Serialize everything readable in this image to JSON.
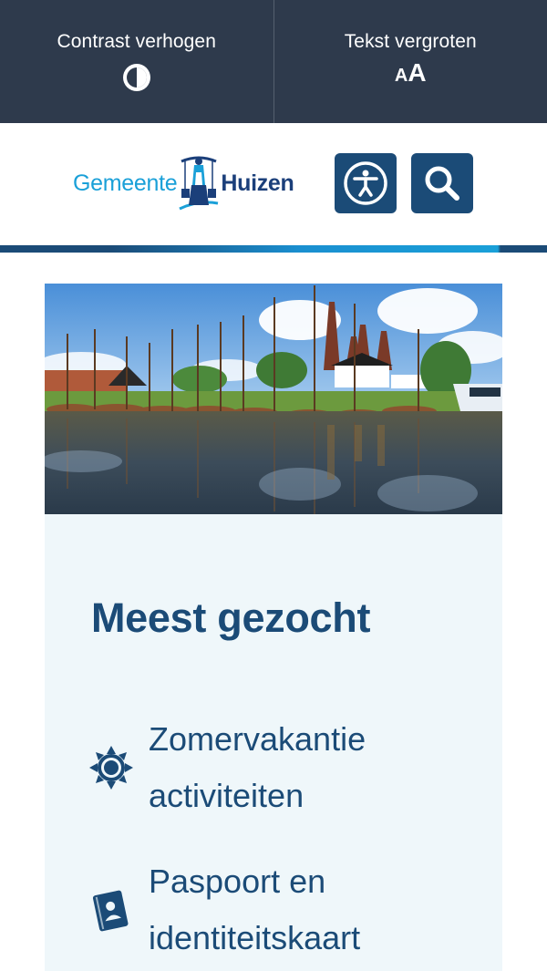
{
  "accessibility_bar": {
    "contrast_label": "Contrast verhogen",
    "text_size_label": "Tekst vergroten",
    "text_size_icon_small": "A",
    "text_size_icon_big": "A"
  },
  "header": {
    "logo_left": "Gemeente",
    "logo_right": "Huizen",
    "accessibility_icon": "accessibility-icon",
    "search_icon": "search-icon"
  },
  "most_searched": {
    "title": "Meest gezocht",
    "items": [
      {
        "label": "Zomervakantie activiteiten",
        "icon": "sun-icon"
      },
      {
        "label": "Paspoort en identiteitskaart",
        "icon": "passport-icon"
      }
    ]
  },
  "colors": {
    "topbar_bg": "#2e3a4c",
    "primary": "#1b4b77",
    "accent": "#1aa0d8",
    "panel_bg": "#eff7fa"
  }
}
